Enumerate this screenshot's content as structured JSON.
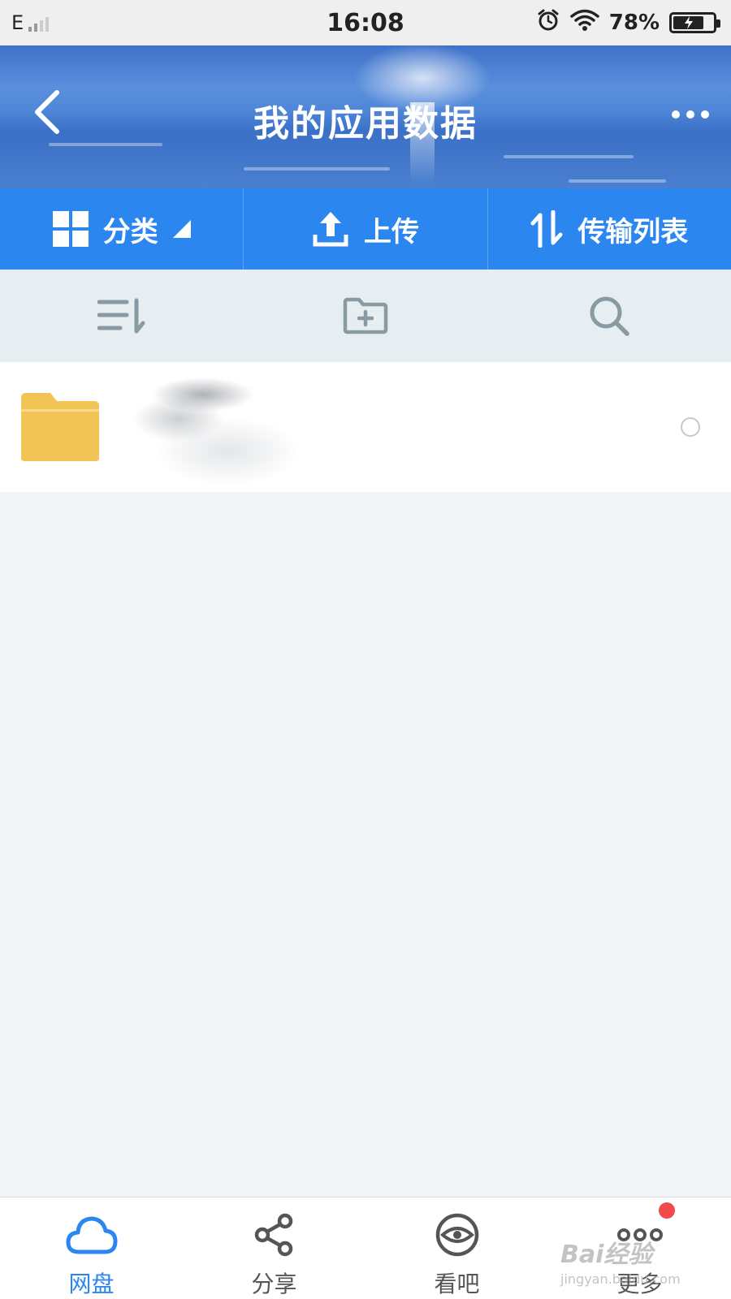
{
  "status_bar": {
    "network": "E",
    "time": "16:08",
    "battery_percent": "78%",
    "battery_level": 0.78
  },
  "header": {
    "title": "我的应用数据",
    "back_icon": "chevron-left-icon",
    "more_icon": "more-dots-icon"
  },
  "action_bar": {
    "items": [
      {
        "label": "分类",
        "icon": "grid-icon"
      },
      {
        "label": "上传",
        "icon": "upload-icon"
      },
      {
        "label": "传输列表",
        "icon": "transfer-arrows-icon"
      }
    ]
  },
  "toolbar": {
    "items": [
      {
        "icon": "sort-icon"
      },
      {
        "icon": "new-folder-icon"
      },
      {
        "icon": "search-icon"
      }
    ]
  },
  "file_list": {
    "items": [
      {
        "type": "folder"
      }
    ]
  },
  "bottom_nav": {
    "items": [
      {
        "label": "网盘",
        "icon": "cloud-icon",
        "active": true
      },
      {
        "label": "分享",
        "icon": "share-icon",
        "active": false
      },
      {
        "label": "看吧",
        "icon": "eye-icon",
        "active": false
      },
      {
        "label": "更多",
        "icon": "more-dots-icon",
        "active": false,
        "badge": true
      }
    ]
  },
  "colors": {
    "accent": "#2b86f0",
    "toolbar_bg": "#e6eef2",
    "folder": "#f2c355",
    "badge": "#f04a4a"
  },
  "watermark": {
    "brand": "Bai经验",
    "url": "jingyan.baidu.com"
  }
}
